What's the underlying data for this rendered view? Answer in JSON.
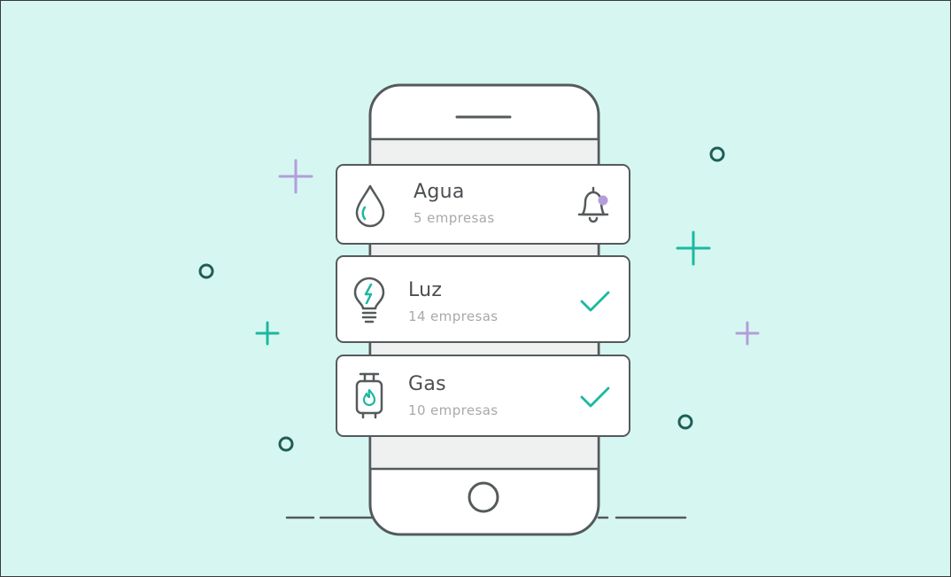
{
  "colors": {
    "background": "#d6f7f1",
    "outline": "#555a5c",
    "teal": "#1cb8a0",
    "purple": "#b39ddb",
    "dark_teal": "#1f5e55",
    "subtitle": "#a7a9ab"
  },
  "services": [
    {
      "title": "Agua",
      "subtitle": "5 empresas",
      "icon": "water-drop-icon",
      "status_icon": "bell-notification-icon"
    },
    {
      "title": "Luz",
      "subtitle": "14 empresas",
      "icon": "light-bulb-icon",
      "status_icon": "checkmark-icon"
    },
    {
      "title": "Gas",
      "subtitle": "10 empresas",
      "icon": "gas-cylinder-icon",
      "status_icon": "checkmark-icon"
    }
  ]
}
